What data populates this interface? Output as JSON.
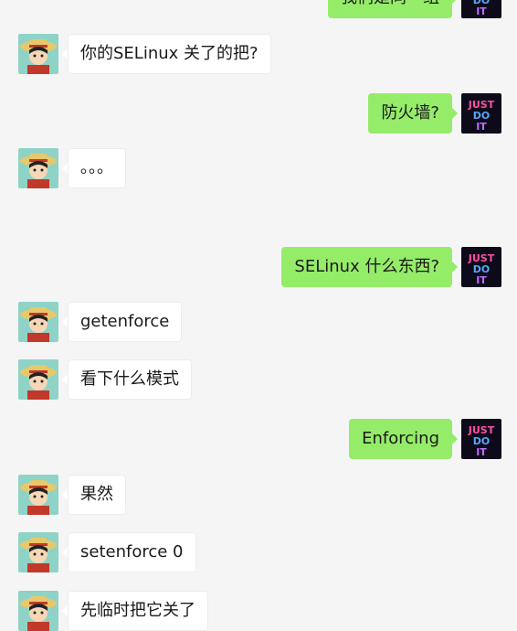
{
  "messages": [
    {
      "side": "right",
      "text": "我们是同一组"
    },
    {
      "side": "left",
      "text": "你的SELinux 关了的把?"
    },
    {
      "side": "right",
      "text": "防火墙?"
    },
    {
      "side": "left",
      "text": "。。。"
    },
    {
      "side": "right",
      "text": "SELinux 什么东西?"
    },
    {
      "side": "left",
      "text": "getenforce"
    },
    {
      "side": "left",
      "text": "看下什么模式"
    },
    {
      "side": "right",
      "text": "Enforcing"
    },
    {
      "side": "left",
      "text": "果然"
    },
    {
      "side": "left",
      "text": "setenforce 0"
    },
    {
      "side": "left",
      "text": "先临时把它关了"
    }
  ],
  "avatars": {
    "self": {
      "icon": "just-do-it-avatar",
      "text": [
        "JUST",
        "DO",
        "IT"
      ]
    },
    "other": {
      "icon": "straw-hat-avatar"
    }
  },
  "colors": {
    "self_bubble": "#95ec69",
    "other_bubble": "#ffffff",
    "background": "#f5f5f5"
  }
}
